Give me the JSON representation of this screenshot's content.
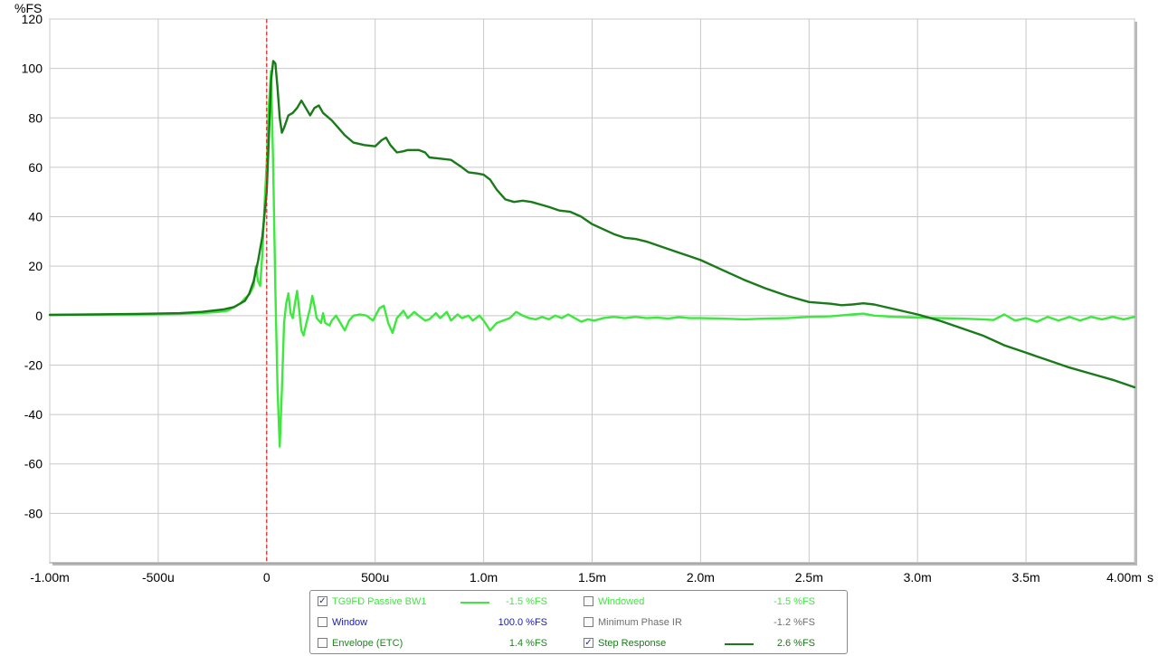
{
  "chart_data": {
    "type": "line",
    "ylabel": "%FS",
    "xunit": "s",
    "xlim": [
      -0.001,
      0.004
    ],
    "ylim": [
      -100,
      120
    ],
    "grid": true,
    "x_ticks": [
      {
        "v": -0.001,
        "label": "-1.00m"
      },
      {
        "v": -0.0005,
        "label": "-500u"
      },
      {
        "v": 0,
        "label": "0"
      },
      {
        "v": 0.0005,
        "label": "500u"
      },
      {
        "v": 0.001,
        "label": "1.0m"
      },
      {
        "v": 0.0015,
        "label": "1.5m"
      },
      {
        "v": 0.002,
        "label": "2.0m"
      },
      {
        "v": 0.0025,
        "label": "2.5m"
      },
      {
        "v": 0.003,
        "label": "3.0m"
      },
      {
        "v": 0.0035,
        "label": "3.5m"
      },
      {
        "v": 0.004,
        "label": "4.00m"
      }
    ],
    "y_ticks": [
      120,
      100,
      80,
      60,
      40,
      20,
      0,
      -20,
      -40,
      -60,
      -80
    ],
    "marker_x": 0,
    "marker_color": "#e02020",
    "series": [
      {
        "name": "TG9FD Passive BW1",
        "color": "#3ee83e",
        "points": [
          [
            -0.001,
            0.3
          ],
          [
            -0.0008,
            0.4
          ],
          [
            -0.0006,
            0.5
          ],
          [
            -0.0004,
            0.7
          ],
          [
            -0.0003,
            1.0
          ],
          [
            -0.00022,
            1.5
          ],
          [
            -0.00018,
            2.0
          ],
          [
            -0.00015,
            3.5
          ],
          [
            -0.00012,
            5.0
          ],
          [
            -0.0001,
            7.0
          ],
          [
            -8e-05,
            8.5
          ],
          [
            -6e-05,
            12.0
          ],
          [
            -5e-05,
            20.0
          ],
          [
            -4e-05,
            14.0
          ],
          [
            -3e-05,
            12.0
          ],
          [
            -2e-05,
            25.0
          ],
          [
            -1e-05,
            45.0
          ],
          [
            0.0,
            62.0
          ],
          [
            1e-05,
            85.0
          ],
          [
            2e-05,
            99.0
          ],
          [
            3e-05,
            60.0
          ],
          [
            4e-05,
            10.0
          ],
          [
            5e-05,
            -30.0
          ],
          [
            6e-05,
            -53.0
          ],
          [
            7e-05,
            -30.0
          ],
          [
            8e-05,
            -3.0
          ],
          [
            9e-05,
            5.0
          ],
          [
            0.0001,
            9.0
          ],
          [
            0.00011,
            1.0
          ],
          [
            0.00012,
            -1.0
          ],
          [
            0.00013,
            5.0
          ],
          [
            0.00014,
            10.0
          ],
          [
            0.00015,
            2.0
          ],
          [
            0.00016,
            -6.0
          ],
          [
            0.00017,
            -8.0
          ],
          [
            0.00018,
            -4.0
          ],
          [
            0.0002,
            3.0
          ],
          [
            0.00021,
            8.0
          ],
          [
            0.00022,
            4.0
          ],
          [
            0.00023,
            -1.0
          ],
          [
            0.00025,
            -3.0
          ],
          [
            0.00026,
            1.0
          ],
          [
            0.00027,
            -3.0
          ],
          [
            0.00029,
            -4.0
          ],
          [
            0.0003,
            -2.0
          ],
          [
            0.00032,
            0.0
          ],
          [
            0.00034,
            -3.0
          ],
          [
            0.00036,
            -6.0
          ],
          [
            0.00038,
            -2.0
          ],
          [
            0.0004,
            0.0
          ],
          [
            0.00043,
            0.5
          ],
          [
            0.00046,
            0.0
          ],
          [
            0.00049,
            -2.0
          ],
          [
            0.00052,
            3.0
          ],
          [
            0.00054,
            4.0
          ],
          [
            0.00056,
            -3.0
          ],
          [
            0.00058,
            -7.0
          ],
          [
            0.0006,
            -1.0
          ],
          [
            0.00063,
            2.0
          ],
          [
            0.00065,
            -1.0
          ],
          [
            0.00068,
            1.5
          ],
          [
            0.0007,
            0.0
          ],
          [
            0.00073,
            -2.0
          ],
          [
            0.00075,
            -1.5
          ],
          [
            0.00078,
            1.0
          ],
          [
            0.0008,
            -1.0
          ],
          [
            0.00083,
            1.5
          ],
          [
            0.00085,
            -2.0
          ],
          [
            0.00088,
            0.5
          ],
          [
            0.0009,
            -1.0
          ],
          [
            0.00093,
            0.0
          ],
          [
            0.00095,
            -2.0
          ],
          [
            0.00098,
            0.0
          ],
          [
            0.001,
            -2.0
          ],
          [
            0.00103,
            -6.0
          ],
          [
            0.00106,
            -3.0
          ],
          [
            0.00109,
            -2.0
          ],
          [
            0.00112,
            -1.0
          ],
          [
            0.00115,
            1.5
          ],
          [
            0.00118,
            0.0
          ],
          [
            0.00121,
            -1.0
          ],
          [
            0.00124,
            -1.5
          ],
          [
            0.00127,
            -0.5
          ],
          [
            0.0013,
            -1.5
          ],
          [
            0.00133,
            0.0
          ],
          [
            0.00136,
            -1.0
          ],
          [
            0.00139,
            0.5
          ],
          [
            0.00142,
            -1.0
          ],
          [
            0.00145,
            -2.5
          ],
          [
            0.00148,
            -1.5
          ],
          [
            0.00151,
            -2.0
          ],
          [
            0.00155,
            -1.0
          ],
          [
            0.0016,
            -0.5
          ],
          [
            0.00165,
            -1.0
          ],
          [
            0.0017,
            -0.5
          ],
          [
            0.00175,
            -1.0
          ],
          [
            0.0018,
            -0.8
          ],
          [
            0.00185,
            -1.2
          ],
          [
            0.0019,
            -0.6
          ],
          [
            0.00195,
            -1.0
          ],
          [
            0.002,
            -1.0
          ],
          [
            0.0021,
            -1.2
          ],
          [
            0.0022,
            -1.5
          ],
          [
            0.0023,
            -1.2
          ],
          [
            0.0024,
            -1.0
          ],
          [
            0.0025,
            -0.5
          ],
          [
            0.0026,
            -0.3
          ],
          [
            0.0027,
            0.5
          ],
          [
            0.00275,
            0.8
          ],
          [
            0.0028,
            0.0
          ],
          [
            0.0029,
            -0.5
          ],
          [
            0.003,
            -0.8
          ],
          [
            0.0031,
            -1.0
          ],
          [
            0.0032,
            -1.2
          ],
          [
            0.0033,
            -1.5
          ],
          [
            0.00335,
            -1.8
          ],
          [
            0.0034,
            0.5
          ],
          [
            0.00345,
            -2.0
          ],
          [
            0.0035,
            -1.0
          ],
          [
            0.00355,
            -2.5
          ],
          [
            0.0036,
            -0.5
          ],
          [
            0.00365,
            -2.0
          ],
          [
            0.0037,
            -0.5
          ],
          [
            0.00375,
            -2.0
          ],
          [
            0.0038,
            -0.5
          ],
          [
            0.00385,
            -1.5
          ],
          [
            0.0039,
            -0.5
          ],
          [
            0.00395,
            -1.5
          ],
          [
            0.004,
            -0.5
          ]
        ]
      },
      {
        "name": "Step Response",
        "color": "#1a7a1a",
        "points": [
          [
            -0.001,
            0.3
          ],
          [
            -0.0008,
            0.5
          ],
          [
            -0.0006,
            0.7
          ],
          [
            -0.0004,
            1.0
          ],
          [
            -0.0003,
            1.5
          ],
          [
            -0.0002,
            2.5
          ],
          [
            -0.00015,
            3.5
          ],
          [
            -0.0001,
            6.0
          ],
          [
            -8e-05,
            9.0
          ],
          [
            -6e-05,
            14.0
          ],
          [
            -4e-05,
            22.0
          ],
          [
            -2e-05,
            32.0
          ],
          [
            0.0,
            50.0
          ],
          [
            1e-05,
            72.0
          ],
          [
            2e-05,
            95.0
          ],
          [
            3e-05,
            103.0
          ],
          [
            4e-05,
            102.0
          ],
          [
            5e-05,
            92.0
          ],
          [
            6e-05,
            80.0
          ],
          [
            7e-05,
            74.0
          ],
          [
            8e-05,
            76.0
          ],
          [
            0.0001,
            81.0
          ],
          [
            0.00012,
            82.0
          ],
          [
            0.00014,
            84.0
          ],
          [
            0.00016,
            87.0
          ],
          [
            0.00018,
            84.0
          ],
          [
            0.0002,
            81.0
          ],
          [
            0.00022,
            84.0
          ],
          [
            0.00024,
            85.0
          ],
          [
            0.00026,
            82.0
          ],
          [
            0.0003,
            79.0
          ],
          [
            0.00033,
            76.0
          ],
          [
            0.00036,
            73.0
          ],
          [
            0.0004,
            70.0
          ],
          [
            0.00045,
            69.0
          ],
          [
            0.0005,
            68.5
          ],
          [
            0.00053,
            71.0
          ],
          [
            0.00055,
            72.0
          ],
          [
            0.00057,
            69.0
          ],
          [
            0.0006,
            66.0
          ],
          [
            0.00063,
            66.5
          ],
          [
            0.00065,
            67.0
          ],
          [
            0.0007,
            67.0
          ],
          [
            0.00073,
            66.0
          ],
          [
            0.00075,
            64.0
          ],
          [
            0.0008,
            63.5
          ],
          [
            0.00085,
            63.0
          ],
          [
            0.0009,
            60.0
          ],
          [
            0.00093,
            58.0
          ],
          [
            0.00097,
            57.5
          ],
          [
            0.001,
            57.0
          ],
          [
            0.00103,
            55.0
          ],
          [
            0.00106,
            51.0
          ],
          [
            0.0011,
            47.0
          ],
          [
            0.00114,
            46.0
          ],
          [
            0.00118,
            46.5
          ],
          [
            0.00122,
            46.0
          ],
          [
            0.00126,
            45.0
          ],
          [
            0.0013,
            44.0
          ],
          [
            0.00135,
            42.5
          ],
          [
            0.0014,
            42.0
          ],
          [
            0.00145,
            40.0
          ],
          [
            0.0015,
            37.0
          ],
          [
            0.00155,
            35.0
          ],
          [
            0.0016,
            33.0
          ],
          [
            0.00165,
            31.5
          ],
          [
            0.0017,
            31.0
          ],
          [
            0.00175,
            30.0
          ],
          [
            0.0018,
            28.5
          ],
          [
            0.00185,
            27.0
          ],
          [
            0.0019,
            25.5
          ],
          [
            0.00195,
            24.0
          ],
          [
            0.002,
            22.5
          ],
          [
            0.0021,
            18.5
          ],
          [
            0.0022,
            14.5
          ],
          [
            0.0023,
            11.0
          ],
          [
            0.0024,
            8.0
          ],
          [
            0.0025,
            5.5
          ],
          [
            0.0026,
            4.8
          ],
          [
            0.00265,
            4.2
          ],
          [
            0.0027,
            4.5
          ],
          [
            0.00275,
            5.0
          ],
          [
            0.0028,
            4.5
          ],
          [
            0.0029,
            2.5
          ],
          [
            0.003,
            0.5
          ],
          [
            0.0031,
            -2.0
          ],
          [
            0.0032,
            -5.0
          ],
          [
            0.0033,
            -8.0
          ],
          [
            0.00335,
            -10.0
          ],
          [
            0.0034,
            -12.0
          ],
          [
            0.0035,
            -15.0
          ],
          [
            0.0036,
            -18.0
          ],
          [
            0.0037,
            -21.0
          ],
          [
            0.0038,
            -23.5
          ],
          [
            0.0039,
            -26.0
          ],
          [
            0.004,
            -29.0
          ]
        ]
      }
    ]
  },
  "legend": {
    "items": [
      {
        "label": "TG9FD Passive BW1",
        "checked": true,
        "color": "#3ee83e",
        "show_line": true,
        "value": "-1.5 %FS",
        "label_color": "#3ee83e",
        "value_color": "#3ee83e"
      },
      {
        "label": "Windowed",
        "checked": false,
        "color": "#3ee83e",
        "show_line": false,
        "value": "-1.5 %FS",
        "label_color": "#3ee83e",
        "value_color": "#3ee83e"
      },
      {
        "label": "Window",
        "checked": false,
        "color": "#1a1ab4",
        "show_line": false,
        "value": "100.0 %FS",
        "label_color": "#1a1ab4",
        "value_color": "#1a1ab4"
      },
      {
        "label": "Minimum Phase IR",
        "checked": false,
        "color": "#7a7a7a",
        "show_line": false,
        "value": "-1.2 %FS",
        "label_color": "#6e6e6e",
        "value_color": "#6e6e6e"
      },
      {
        "label": "Envelope (ETC)",
        "checked": false,
        "color": "#1a8a1a",
        "show_line": false,
        "value": "1.4 %FS",
        "label_color": "#1a8a1a",
        "value_color": "#1a8a1a"
      },
      {
        "label": "Step Response",
        "checked": true,
        "color": "#1a7a1a",
        "show_line": true,
        "value": "2.6 %FS",
        "label_color": "#1a7a1a",
        "value_color": "#1a7a1a"
      }
    ]
  }
}
